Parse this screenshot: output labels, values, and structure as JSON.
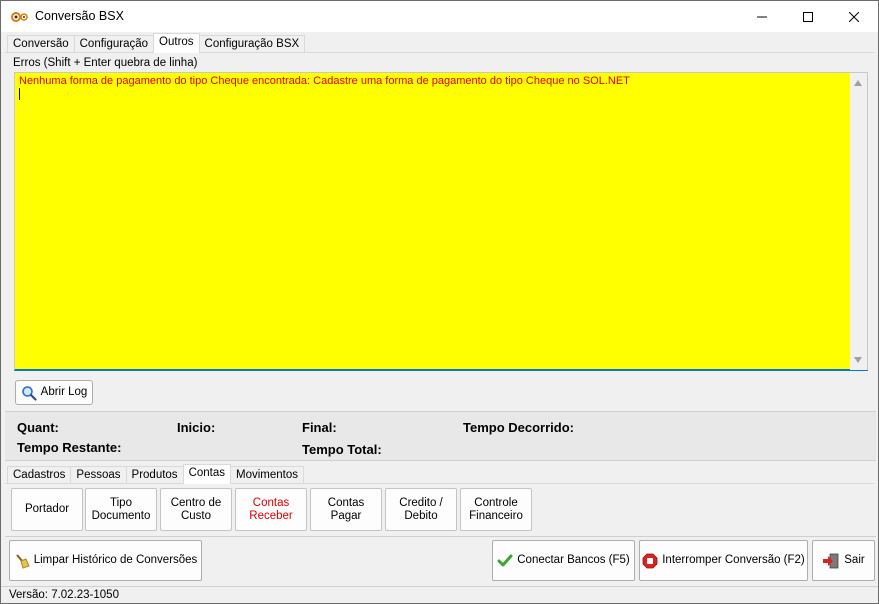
{
  "window": {
    "title": "Conversão BSX"
  },
  "tabs": [
    {
      "label": "Conversão"
    },
    {
      "label": "Configuração"
    },
    {
      "label": "Outros",
      "active": true
    },
    {
      "label": "Configuração BSX"
    }
  ],
  "errors": {
    "label": "Erros (Shift + Enter quebra de linha)",
    "text": "Nenhuma forma de pagamento do tipo Cheque encontrada: Cadastre uma forma de pagamento do tipo Cheque no SOL.NET",
    "background": "#ffff00",
    "text_color": "#e00000"
  },
  "log_button": {
    "label": "Abrir Log",
    "icon": "magnifier-icon"
  },
  "stats": {
    "quant": "Quant:",
    "inicio": "Inicio:",
    "final": "Final:",
    "tempo_decorrido": "Tempo Decorrido:",
    "tempo_restante": "Tempo Restante:",
    "tempo_total": "Tempo Total:"
  },
  "sub_tabs": [
    {
      "label": "Cadastros"
    },
    {
      "label": "Pessoas"
    },
    {
      "label": "Produtos"
    },
    {
      "label": "Contas",
      "active": true
    },
    {
      "label": "Movimentos"
    }
  ],
  "sub_buttons": [
    {
      "line1": "Portador",
      "line2": ""
    },
    {
      "line1": "Tipo",
      "line2": "Documento"
    },
    {
      "line1": "Centro de",
      "line2": "Custo"
    },
    {
      "line1": "Contas",
      "line2": "Receber",
      "highlight": "#e00000"
    },
    {
      "line1": "Contas",
      "line2": "Pagar"
    },
    {
      "line1": "Credito /",
      "line2": "Debito"
    },
    {
      "line1": "Controle",
      "line2": "Financeiro"
    }
  ],
  "actions": {
    "clear_history": "Limpar Histórico de Conversões",
    "connect": "Conectar Bancos (F5)",
    "interrupt": "Interromper Conversão (F2)",
    "exit": "Sair"
  },
  "status": {
    "version": "Versão: 7.02.23-1050"
  }
}
